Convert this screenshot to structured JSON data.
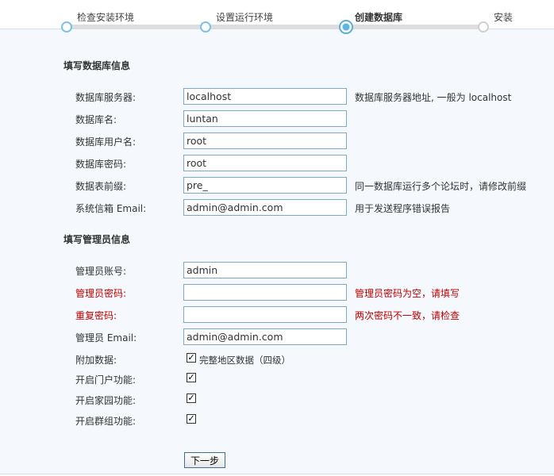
{
  "steps": [
    {
      "label": "检查安装环境",
      "state": "done"
    },
    {
      "label": "设置运行环境",
      "state": "done"
    },
    {
      "label": "创建数据库",
      "state": "active"
    },
    {
      "label": "安装",
      "state": "todo"
    }
  ],
  "db_section": {
    "title": "填写数据库信息",
    "fields": {
      "server": {
        "label": "数据库服务器:",
        "value": "localhost",
        "hint": "数据库服务器地址, 一般为 localhost"
      },
      "name": {
        "label": "数据库名:",
        "value": "luntan"
      },
      "user": {
        "label": "数据库用户名:",
        "value": "root"
      },
      "password": {
        "label": "数据库密码:",
        "value": "root"
      },
      "prefix": {
        "label": "数据表前缀:",
        "value": "pre_",
        "hint": "同一数据库运行多个论坛时，请修改前缀"
      },
      "email": {
        "label": "系统信箱 Email:",
        "value": "admin@admin.com",
        "hint": "用于发送程序错误报告"
      }
    }
  },
  "admin_section": {
    "title": "填写管理员信息",
    "fields": {
      "account": {
        "label": "管理员账号:",
        "value": "admin"
      },
      "password": {
        "label": "管理员密码:",
        "value": "",
        "error": "管理员密码为空，请填写"
      },
      "repeat": {
        "label": "重复密码:",
        "value": "",
        "error": "两次密码不一致，请检查"
      },
      "email": {
        "label": "管理员 Email:",
        "value": "admin@admin.com"
      }
    }
  },
  "options": {
    "extra_data": {
      "label": "附加数据:",
      "checkbox_label": "完整地区数据（四级）",
      "checked": true
    },
    "portal": {
      "label": "开启门户功能:",
      "checked": true
    },
    "home": {
      "label": "开启家园功能:",
      "checked": true
    },
    "group": {
      "label": "开启群组功能:",
      "checked": true
    }
  },
  "next_button": "下一步",
  "colors": {
    "error": "#c00000",
    "accent": "#5aaed8"
  }
}
